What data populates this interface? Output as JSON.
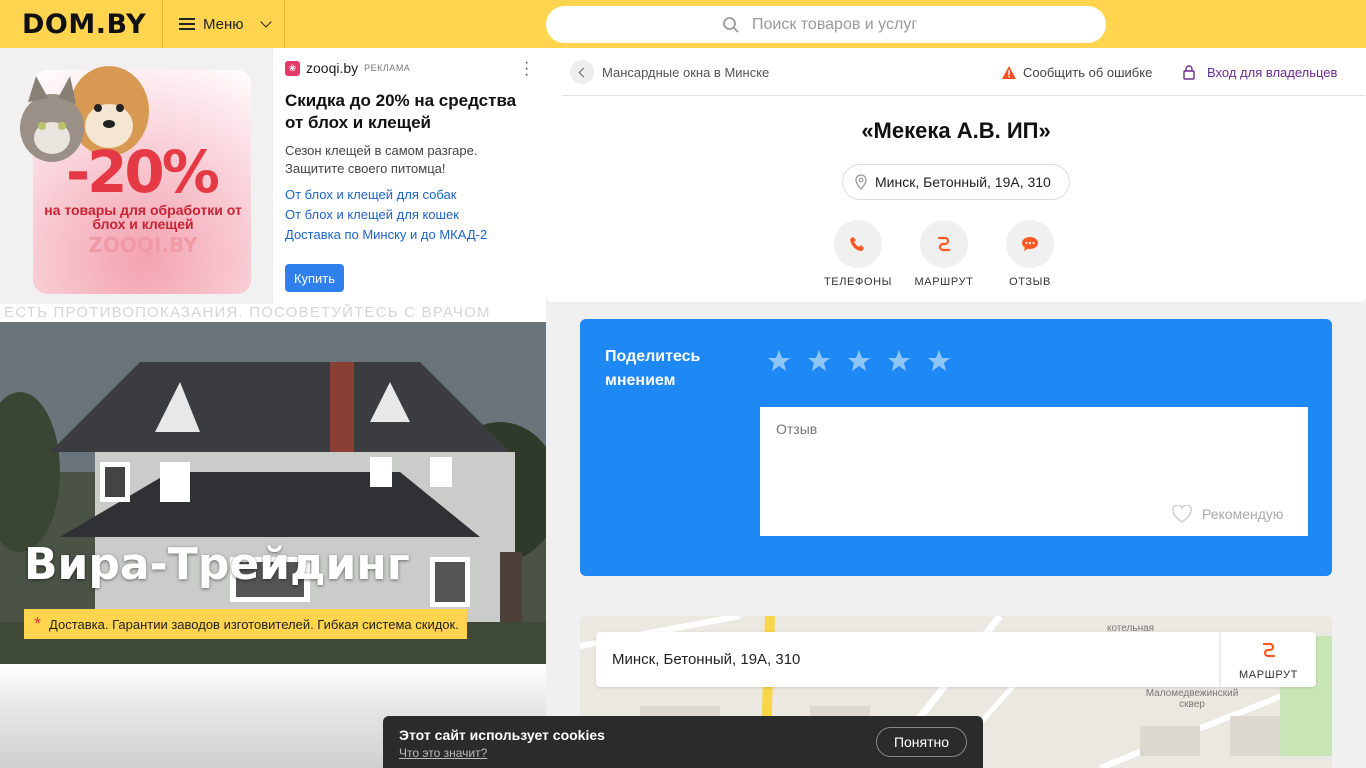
{
  "header": {
    "logo": "DOM.BY",
    "menu_label": "Меню",
    "search_placeholder": "Поиск товаров и услуг"
  },
  "ad": {
    "image_text": {
      "discount": "-20%",
      "subtitle": "на товары для обработки от блох и клещей",
      "brand": "ZOOQI.BY"
    },
    "source": "zooqi.by",
    "tag": "РЕКЛАМА",
    "title": "Скидка до 20% на средства от блох и клещей",
    "text": "Сезон клещей в самом разгаре. Защитите своего питомца!",
    "links": [
      "От блох и клещей для собак",
      "От блох и клещей для кошек",
      "Доставка по Минску и до МКАД-2"
    ],
    "button": "Купить",
    "disclaimer": "ЕСТЬ ПРОТИВОПОКАЗАНИЯ. ПОСОВЕТУЙТЕСЬ С ВРАЧОМ"
  },
  "hero": {
    "company": "Вира-Трейдинг",
    "badge": "Доставка. Гарантии заводов изготовителей. Гибкая система скидок."
  },
  "card": {
    "breadcrumb": "Мансардные окна в Минске",
    "report": "Сообщить об ошибке",
    "owner_login": "Вход для владельцев",
    "title": "«Мекека А.В. ИП»",
    "address": "Минск, Бетонный, 19А, 310",
    "actions": [
      "ТЕЛЕФОНЫ",
      "МАРШРУТ",
      "ОТЗЫВ"
    ]
  },
  "review": {
    "title": "Поделитесь мнением",
    "placeholder": "Отзыв",
    "recommend": "Рекомендую",
    "stars": 5
  },
  "map": {
    "address": "Минск, Бетонный, 19А, 310",
    "route": "МАРШРУТ",
    "labels": [
      "котельная",
      "Маломедвежинский сквер"
    ]
  },
  "cookie": {
    "text": "Этот сайт использует cookies",
    "link": "Что это значит?",
    "button": "Понятно"
  },
  "colors": {
    "header": "#ffd54f",
    "review_bg": "#1e88f5",
    "accent_orange": "#ff5722",
    "link_blue": "#1d63c8",
    "owner_purple": "#6a2c91"
  }
}
